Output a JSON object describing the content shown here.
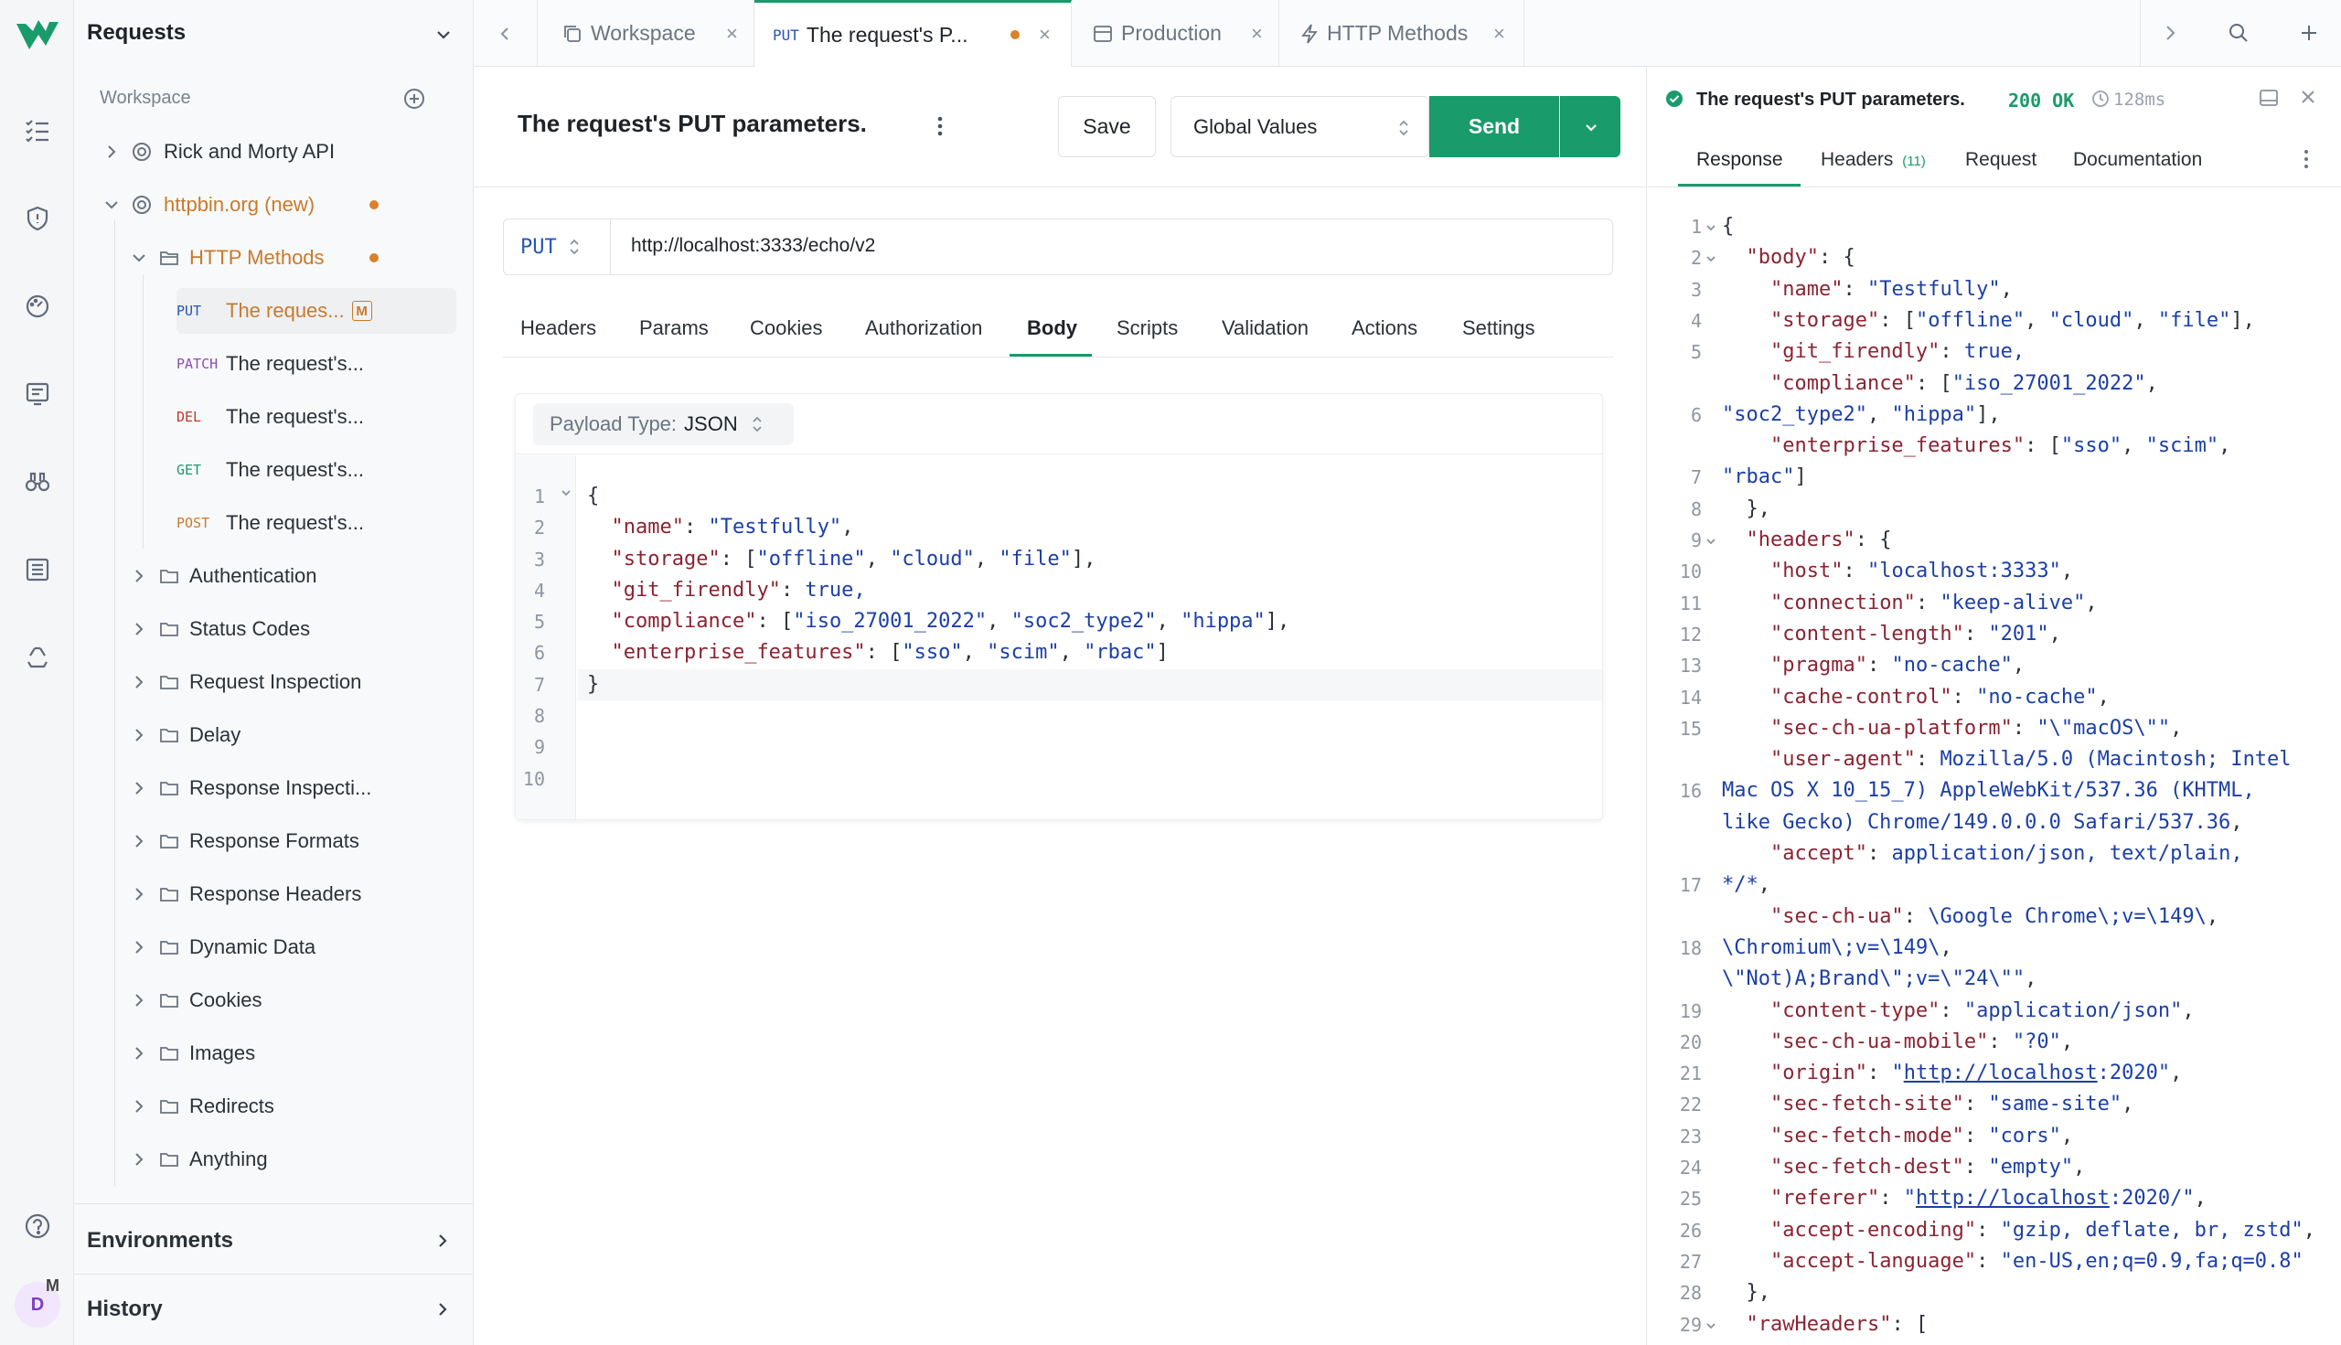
{
  "app": {
    "title": "Requests"
  },
  "sidebar": {
    "workspace_label": "Workspace",
    "items": [
      {
        "label": "Rick and Morty API"
      },
      {
        "label": "httpbin.org (new)"
      },
      {
        "label": "HTTP Methods"
      },
      {
        "method": "PUT",
        "label": "The reques...",
        "badge": "M"
      },
      {
        "method": "PATCH",
        "label": "The request's..."
      },
      {
        "method": "DEL",
        "label": "The request's..."
      },
      {
        "method": "GET",
        "label": "The request's..."
      },
      {
        "method": "POST",
        "label": "The request's..."
      },
      {
        "label": "Authentication"
      },
      {
        "label": "Status Codes"
      },
      {
        "label": "Request Inspection"
      },
      {
        "label": "Delay"
      },
      {
        "label": "Response Inspecti..."
      },
      {
        "label": "Response Formats"
      },
      {
        "label": "Response Headers"
      },
      {
        "label": "Dynamic Data"
      },
      {
        "label": "Cookies"
      },
      {
        "label": "Images"
      },
      {
        "label": "Redirects"
      },
      {
        "label": "Anything"
      }
    ],
    "environments": "Environments",
    "history": "History",
    "avatar_primary": "D",
    "avatar_secondary": "M"
  },
  "tabs": [
    {
      "label": "Workspace"
    },
    {
      "method": "PUT",
      "label": "The request's P..."
    },
    {
      "label": "Production"
    },
    {
      "label": "HTTP Methods"
    }
  ],
  "request": {
    "title": "The request's PUT parameters.",
    "save": "Save",
    "environment": "Global Values",
    "send": "Send",
    "method": "PUT",
    "url": "http://localhost:3333/echo/v2",
    "subtabs": [
      "Headers",
      "Params",
      "Cookies",
      "Authorization",
      "Body",
      "Scripts",
      "Validation",
      "Actions",
      "Settings"
    ],
    "active_subtab": "Body",
    "payload_label": "Payload Type:",
    "payload_value": "JSON",
    "line_numbers": [
      "1",
      "2",
      "3",
      "4",
      "5",
      "6",
      "7",
      "8",
      "9",
      "10"
    ],
    "body_lines": [
      "{",
      "  \"name\": \"Testfully\",",
      "  \"storage\": [\"offline\", \"cloud\", \"file\"],",
      "  \"git_firendly\": true,",
      "  \"compliance\": [\"iso_27001_2022\", \"soc2_type2\", \"hippa\"],",
      "  \"enterprise_features\": [\"sso\", \"scim\", \"rbac\"]",
      "}"
    ]
  },
  "response": {
    "title": "The request's PUT parameters.",
    "status": "200 OK",
    "time": "128ms",
    "tabs": [
      "Response",
      "Headers",
      "Request",
      "Documentation"
    ],
    "headers_count": "(11)",
    "lines": [
      {
        "n": "1",
        "t": "{"
      },
      {
        "n": "2",
        "t": "  \"body\": {"
      },
      {
        "n": "3",
        "t": "    \"name\": \"Testfully\","
      },
      {
        "n": "4",
        "t": "    \"storage\": [\"offline\", \"cloud\", \"file\"],"
      },
      {
        "n": "5",
        "t": "    \"git_firendly\": true,"
      },
      {
        "n": "",
        "t": "    \"compliance\": [\"iso_27001_2022\","
      },
      {
        "n": "6",
        "t": "\"soc2_type2\", \"hippa\"],"
      },
      {
        "n": "",
        "t": "    \"enterprise_features\": [\"sso\", \"scim\","
      },
      {
        "n": "7",
        "t": "\"rbac\"]"
      },
      {
        "n": "8",
        "t": "  },"
      },
      {
        "n": "9",
        "t": "  \"headers\": {"
      },
      {
        "n": "10",
        "t": "    \"host\": \"localhost:3333\","
      },
      {
        "n": "11",
        "t": "    \"connection\": \"keep-alive\","
      },
      {
        "n": "12",
        "t": "    \"content-length\": \"201\","
      },
      {
        "n": "13",
        "t": "    \"pragma\": \"no-cache\","
      },
      {
        "n": "14",
        "t": "    \"cache-control\": \"no-cache\","
      },
      {
        "n": "15",
        "t": "    \"sec-ch-ua-platform\": \"\\\"macOS\\\"\","
      },
      {
        "n": "",
        "t": "    \"user-agent\": \"Mozilla/5.0 (Macintosh; Intel"
      },
      {
        "n": "16",
        "t": "Mac OS X 10_15_7) AppleWebKit/537.36 (KHTML,"
      },
      {
        "n": "",
        "t": "like Gecko) Chrome/149.0.0.0 Safari/537.36\","
      },
      {
        "n": "",
        "t": "    \"accept\": \"application/json, text/plain,"
      },
      {
        "n": "17",
        "t": "*/*\","
      },
      {
        "n": "",
        "t": "    \"sec-ch-ua\": \"\\\"Google Chrome\\\";v=\\\"149\\\","
      },
      {
        "n": "18",
        "t": "\\\"Chromium\\\";v=\\\"149\\\","
      },
      {
        "n": "",
        "t": "\\\"Not)A;Brand\\\";v=\\\"24\\\"\","
      },
      {
        "n": "19",
        "t": "    \"content-type\": \"application/json\","
      },
      {
        "n": "20",
        "t": "    \"sec-ch-ua-mobile\": \"?0\","
      },
      {
        "n": "21",
        "t": "    \"origin\": \"http://localhost:2020\","
      },
      {
        "n": "22",
        "t": "    \"sec-fetch-site\": \"same-site\","
      },
      {
        "n": "23",
        "t": "    \"sec-fetch-mode\": \"cors\","
      },
      {
        "n": "24",
        "t": "    \"sec-fetch-dest\": \"empty\","
      },
      {
        "n": "25",
        "t": "    \"referer\": \"http://localhost:2020/\","
      },
      {
        "n": "26",
        "t": "    \"accept-encoding\": \"gzip, deflate, br, zstd\","
      },
      {
        "n": "27",
        "t": "    \"accept-language\": \"en-US,en;q=0.9,fa;q=0.8\""
      },
      {
        "n": "28",
        "t": "  },"
      },
      {
        "n": "29",
        "t": "  \"rawHeaders\": ["
      }
    ]
  },
  "colors": {
    "accent": "#1a9b6c",
    "orange": "#c97a2c",
    "method_blue": "#2456b8"
  }
}
